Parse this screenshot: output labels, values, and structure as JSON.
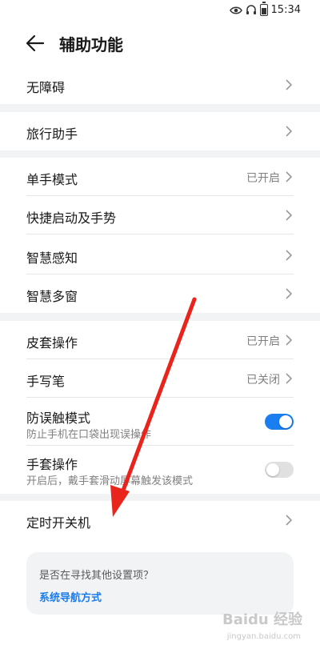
{
  "status_bar": {
    "time": "15:34",
    "icons": [
      "eye-icon",
      "headset-icon",
      "battery-icon"
    ]
  },
  "header": {
    "title": "辅助功能",
    "back_icon": "back-arrow-icon"
  },
  "groups": [
    {
      "items": [
        {
          "label": "无障碍",
          "status": ""
        }
      ]
    },
    {
      "items": [
        {
          "label": "旅行助手",
          "status": ""
        }
      ]
    },
    {
      "items": [
        {
          "label": "单手模式",
          "status": "已开启"
        },
        {
          "label": "快捷启动及手势",
          "status": ""
        },
        {
          "label": "智慧感知",
          "status": ""
        },
        {
          "label": "智慧多窗",
          "status": ""
        }
      ]
    },
    {
      "items": [
        {
          "label": "皮套操作",
          "status": "已开启"
        },
        {
          "label": "手写笔",
          "status": "已关闭"
        },
        {
          "label": "防误触模式",
          "sub": "防止手机在口袋出现误操作",
          "toggle": "on"
        },
        {
          "label": "手套操作",
          "sub": "开启后，戴手套滑动屏幕触发该模式",
          "toggle": "off"
        }
      ]
    },
    {
      "items": [
        {
          "label": "定时开关机",
          "status": ""
        }
      ]
    }
  ],
  "suggestion": {
    "question": "是否在寻找其他设置项？",
    "link": "系统导航方式"
  },
  "overlay": {
    "arrow_color": "#e8241c"
  },
  "watermark": {
    "text": "Baidu 经验",
    "sub": "jingyan.baidu.com"
  },
  "colors": {
    "accent": "#1a7df0",
    "group_gap": "#f1f3f5"
  }
}
